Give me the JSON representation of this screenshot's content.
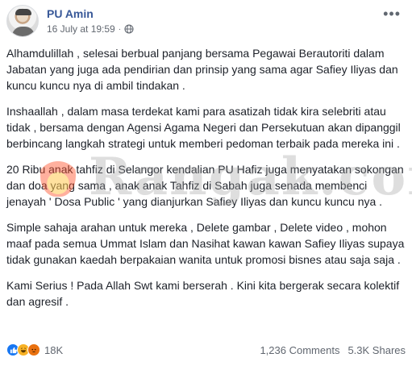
{
  "post": {
    "author": "PU Amin",
    "date": "16 July at 19:59",
    "paragraphs": [
      "Alhamdulillah , selesai berbual panjang bersama Pegawai Berautoriti dalam Jabatan yang juga ada pendirian dan prinsip yang sama agar Safiey Iliyas dan kuncu kuncu nya di ambil tindakan .",
      "Inshaallah , dalam masa terdekat kami para asatizah tidak kira selebriti atau tidak , bersama dengan Agensi Agama Negeri dan Persekutuan akan dipanggil berbincang langkah strategi untuk memberi pedoman terbaik pada mereka ini .",
      "20 Ribu anak tahfiz di Selangor kendalian PU Hafiz juga menyatakan sokongan dan doa yang sama , anak anak Tahfiz di Sabah juga senada membenci jenayah ' Dosa Public ' yang dianjurkan Safiey Iliyas dan kuncu kuncu nya .",
      "Simple sahaja arahan untuk mereka , Delete gambar , Delete video , mohon maaf pada semua Ummat Islam dan Nasihat kawan kawan Safiey Iliyas supaya tidak gunakan kaedah berpakaian wanita untuk promosi bisnes atau saja saja .",
      "Kami Serius ! Pada Allah Swt kami berserah . Kini kita bergerak secara kolektif dan agresif ."
    ]
  },
  "watermark": {
    "text": "Rangak.com"
  },
  "footer": {
    "reaction_count": "18K",
    "comments": "1,236 Comments",
    "shares": "5.3K Shares"
  },
  "icons": {
    "globe": "globe-icon",
    "more": "more-options-icon",
    "like": "like-reaction-icon",
    "haha": "haha-reaction-icon",
    "angry": "angry-reaction-icon"
  },
  "colors": {
    "author": "#385898",
    "like": "#1877f2",
    "haha": "#f7b125",
    "angry": "#e9710f"
  }
}
